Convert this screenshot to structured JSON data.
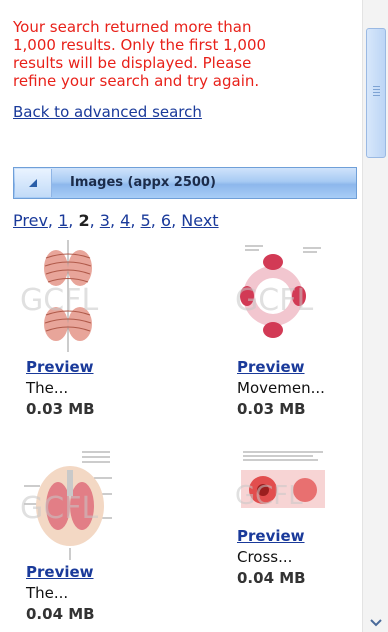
{
  "warning": {
    "lines": [
      "Your search returned more than",
      "1,000 results. Only the first 1,000",
      "results will be displayed. Please",
      "refine your search and try again."
    ],
    "back_link": "Back to advanced search"
  },
  "section": {
    "title": "Images (appx 2500)",
    "toggle_icon": "triangle-toggle-icon"
  },
  "pager": {
    "prev": "Prev",
    "sep": ",",
    "pages": [
      "1",
      "2",
      "3",
      "4",
      "5",
      "6"
    ],
    "current_page": "2",
    "next": "Next"
  },
  "results": [
    {
      "preview": "Preview",
      "title": "The...",
      "size": "0.03 MB",
      "thumb_icon": "lungs-anatomy-thumbnail"
    },
    {
      "preview": "Preview",
      "title": "Movemen...",
      "size": "0.03 MB",
      "thumb_icon": "circular-diagram-thumbnail"
    },
    {
      "preview": "Preview",
      "title": "The...",
      "size": "0.04 MB",
      "thumb_icon": "lungs-color-thumbnail"
    },
    {
      "preview": "Preview",
      "title": "Cross...",
      "size": "0.04 MB",
      "thumb_icon": "cross-section-thumbnail"
    }
  ],
  "watermark": "GCFL",
  "colors": {
    "warning": "#e8211a",
    "link": "#1a3a9a",
    "header": "#a7caf3"
  }
}
